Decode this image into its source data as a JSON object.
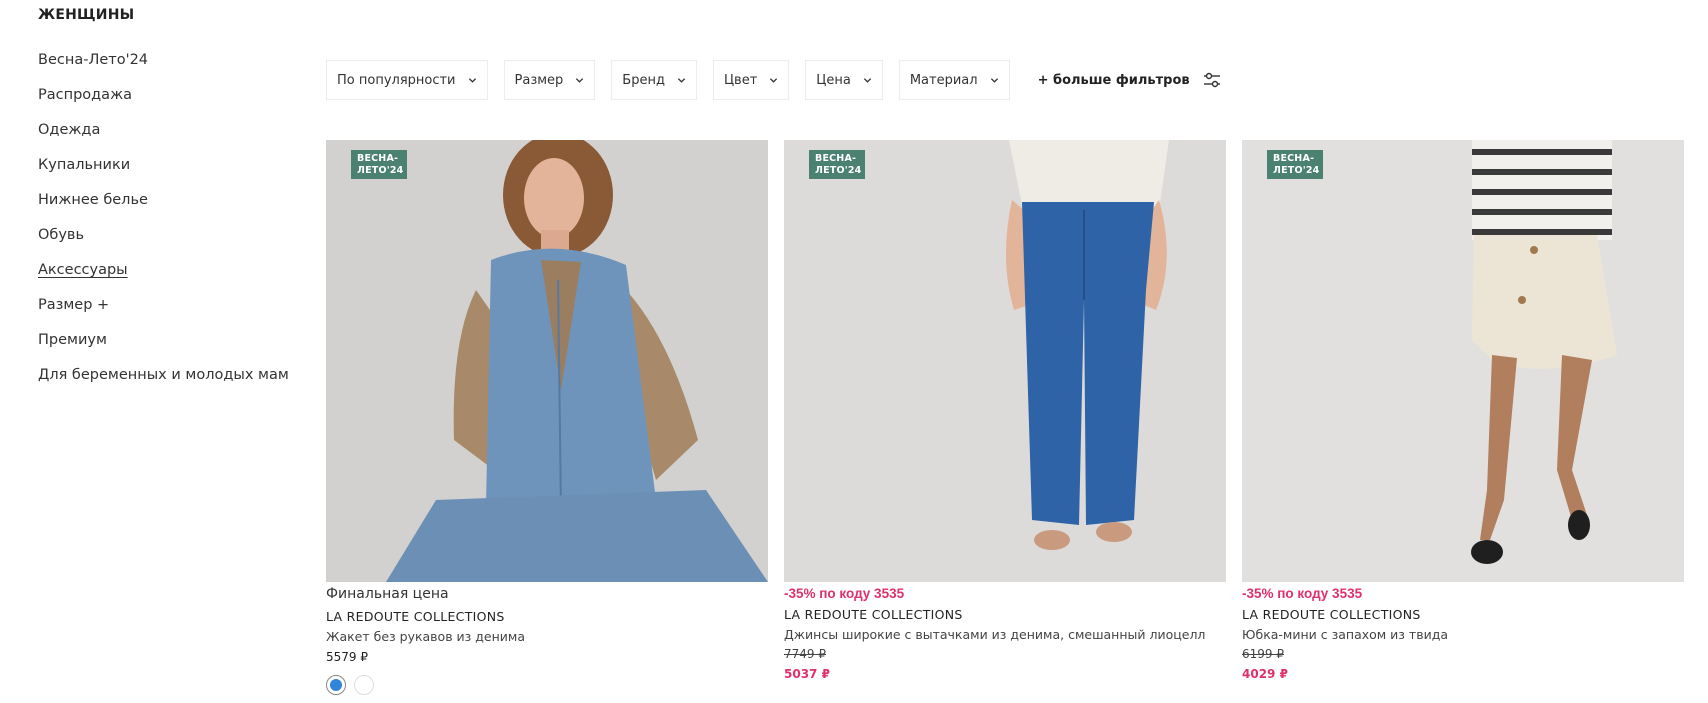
{
  "sidebar": {
    "title": "ЖЕНЩИНЫ",
    "items": [
      {
        "label": "Весна-Лето'24"
      },
      {
        "label": "Распродажа"
      },
      {
        "label": "Одежда"
      },
      {
        "label": "Купальники"
      },
      {
        "label": "Нижнее белье"
      },
      {
        "label": "Обувь"
      },
      {
        "label": "Аксессуары"
      },
      {
        "label": "Размер +"
      },
      {
        "label": "Премиум"
      },
      {
        "label": "Для беременных и молодых мам"
      }
    ]
  },
  "filters": {
    "sort": "По популярности",
    "size": "Размер",
    "brand": "Бренд",
    "color": "Цвет",
    "price": "Цена",
    "material": "Материал",
    "more": "+ больше фильтров"
  },
  "products": [
    {
      "badge_line1": "ВЕСНА-",
      "badge_line2": "ЛЕТО'24",
      "label": "Финальная цена",
      "brand": "LA REDOUTE COLLECTIONS",
      "name": "Жакет без рукавов из денима",
      "price": "5579 ₽"
    },
    {
      "badge_line1": "ВЕСНА-",
      "badge_line2": "ЛЕТО'24",
      "promo": "-35% по коду 3535",
      "brand": "LA REDOUTE COLLECTIONS",
      "name": "Джинсы широкие с вытачками из денима, смешанный лиоцелл",
      "old_price": "7749 ₽",
      "new_price": "5037 ₽"
    },
    {
      "badge_line1": "ВЕСНА-",
      "badge_line2": "ЛЕТО'24",
      "promo": "-35% по коду 3535",
      "brand": "LA REDOUTE COLLECTIONS",
      "name": "Юбка-мини с запахом из твида",
      "old_price": "6199 ₽",
      "new_price": "4029 ₽"
    }
  ],
  "colors": {
    "accent_pink": "#e0306b",
    "badge_green": "#4b8170",
    "swatch_blue": "#2f86d8"
  }
}
